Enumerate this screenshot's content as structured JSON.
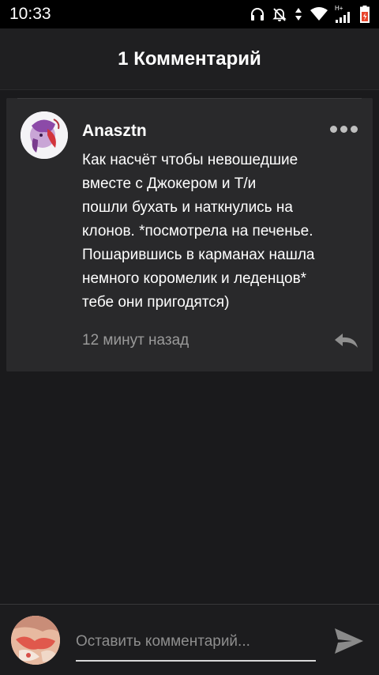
{
  "status_bar": {
    "time": "10:33",
    "network_label": "H+",
    "icons": [
      "headphones-icon",
      "bell-off-icon",
      "data-arrows-icon",
      "wifi-icon",
      "signal-icon",
      "battery-icon"
    ]
  },
  "header": {
    "title": "1 Комментарий"
  },
  "comment": {
    "author": "Anasztn",
    "body_lines": [
      "Как насчёт чтобы невошедшие",
      "вместе с Джокером и Т/и",
      "пошли бухать и наткнулись на",
      "клонов. *посмотрела на печенье.",
      "Пошарившись  в карманах нашла",
      "немного коромелик и леденцов*",
      "тебе они пригодятся)"
    ],
    "timestamp": "12 минут назад",
    "icons": [
      "more-options-icon",
      "reply-icon"
    ]
  },
  "composer": {
    "placeholder": "Оставить комментарий...",
    "value": "",
    "icons": [
      "send-icon"
    ]
  },
  "colors": {
    "background": "#1a1a1c",
    "card": "#29292b",
    "status_bar": "#000000",
    "secondary_text": "#9a9a9a"
  }
}
